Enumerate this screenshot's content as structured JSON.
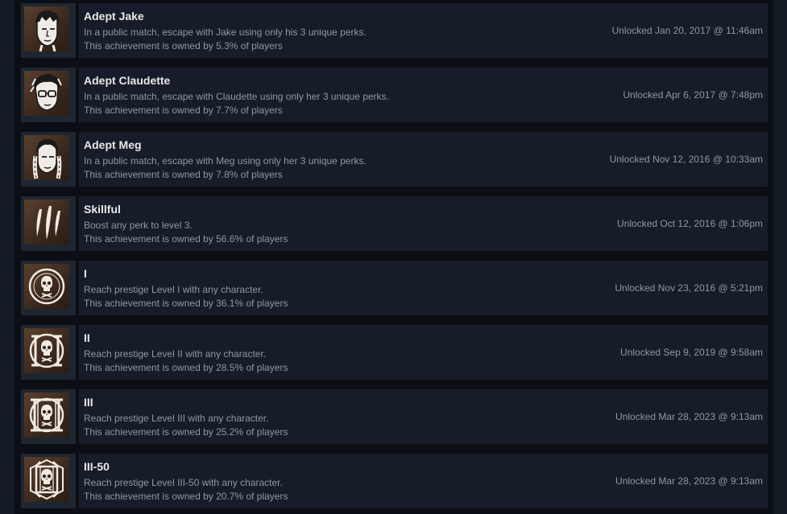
{
  "achievements": [
    {
      "icon": "adept-jake-icon",
      "title": "Adept Jake",
      "description": "In a public match, escape with Jake using only his 3 unique perks.",
      "owned": "This achievement is owned by 5.3% of players",
      "unlocked": "Unlocked Jan 20, 2017 @ 11:46am"
    },
    {
      "icon": "adept-claudette-icon",
      "title": "Adept Claudette",
      "description": "In a public match, escape with Claudette using only her 3 unique perks.",
      "owned": "This achievement is owned by 7.7% of players",
      "unlocked": "Unlocked Apr 6, 2017 @ 7:48pm"
    },
    {
      "icon": "adept-meg-icon",
      "title": "Adept Meg",
      "description": "In a public match, escape with Meg using only her 3 unique perks.",
      "owned": "This achievement is owned by 7.8% of players",
      "unlocked": "Unlocked Nov 12, 2016 @ 10:33am"
    },
    {
      "icon": "claw-marks-icon",
      "title": "Skillful",
      "description": "Boost any perk to level 3.",
      "owned": "This achievement is owned by 56.6% of players",
      "unlocked": "Unlocked Oct 12, 2016 @ 1:06pm"
    },
    {
      "icon": "prestige-1-skull-icon",
      "title": "I",
      "description": "Reach prestige Level I with any character.",
      "owned": "This achievement is owned by 36.1% of players",
      "unlocked": "Unlocked Nov 23, 2016 @ 5:21pm"
    },
    {
      "icon": "prestige-2-skull-icon",
      "title": "II",
      "description": "Reach prestige Level II with any character.",
      "owned": "This achievement is owned by 28.5% of players",
      "unlocked": "Unlocked Sep 9, 2019 @ 9:58am"
    },
    {
      "icon": "prestige-3-skull-icon",
      "title": "III",
      "description": "Reach prestige Level III with any character.",
      "owned": "This achievement is owned by 25.2% of players",
      "unlocked": "Unlocked Mar 28, 2023 @ 9:13am"
    },
    {
      "icon": "prestige-3-50-skull-icon",
      "title": "III-50",
      "description": "Reach prestige Level III-50 with any character.",
      "owned": "This achievement is owned by 20.7% of players",
      "unlocked": "Unlocked Mar 28, 2023 @ 9:13am"
    }
  ]
}
